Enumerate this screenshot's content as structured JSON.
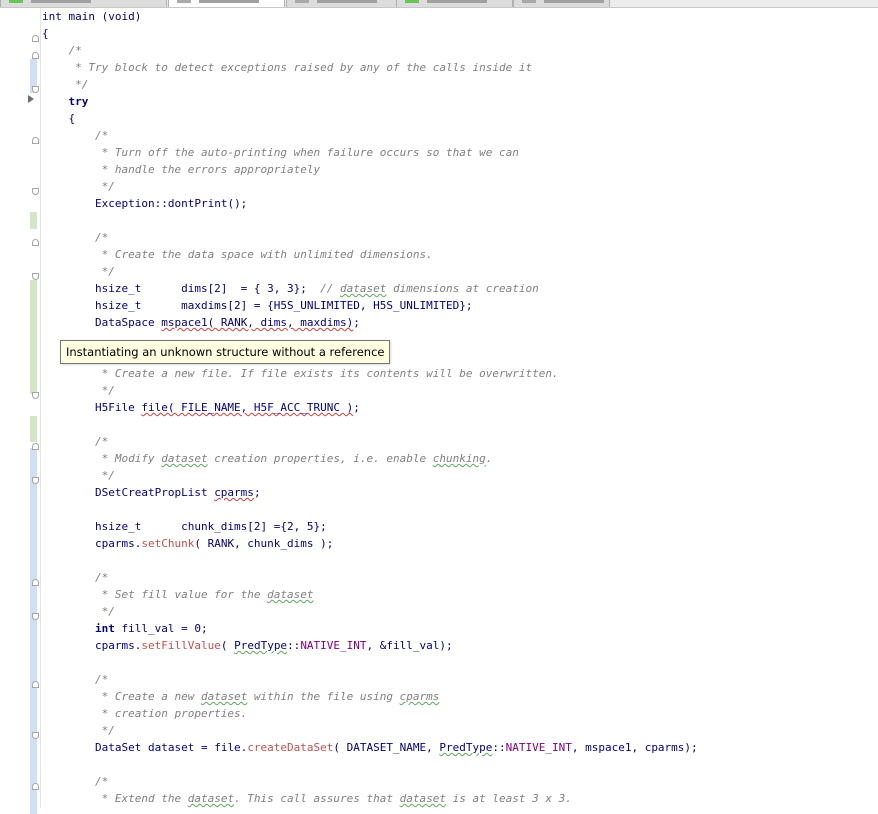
{
  "editor": {
    "lines": [
      [
        {
          "t": "int main (void)",
          "c": "kw-plain"
        }
      ],
      [
        {
          "t": "{"
        }
      ],
      [
        {
          "t": "    /*",
          "c": "cm"
        }
      ],
      [
        {
          "t": "     * Try block to detect exceptions raised by any of the calls inside it",
          "c": "cm"
        }
      ],
      [
        {
          "t": "     */",
          "c": "cm"
        }
      ],
      [
        {
          "t": "    "
        },
        {
          "t": "try",
          "c": "kw"
        }
      ],
      [
        {
          "t": "    {"
        }
      ],
      [
        {
          "t": "        /*",
          "c": "cm"
        }
      ],
      [
        {
          "t": "         * Turn off the auto-printing when failure occurs so that we can",
          "c": "cm"
        }
      ],
      [
        {
          "t": "         * handle the errors appropriately",
          "c": "cm"
        }
      ],
      [
        {
          "t": "         */",
          "c": "cm"
        }
      ],
      [
        {
          "t": "        "
        },
        {
          "t": "Exception",
          "c": "ty"
        },
        {
          "t": "::dontPrint();"
        }
      ],
      [
        {
          "t": ""
        }
      ],
      [
        {
          "t": "        /*",
          "c": "cm"
        }
      ],
      [
        {
          "t": "         * Create the data space with unlimited dimensions.",
          "c": "cm"
        }
      ],
      [
        {
          "t": "         */",
          "c": "cm"
        }
      ],
      [
        {
          "t": "        hsize_t      dims[2]  = { 3, 3};  "
        },
        {
          "t": "// ",
          "c": "cm"
        },
        {
          "t": "dataset",
          "c": "cm gq"
        },
        {
          "t": " dimensions at creation",
          "c": "cm"
        }
      ],
      [
        {
          "t": "        hsize_t      maxdims[2] = {H5S_UNLIMITED, H5S_UNLIMITED};"
        }
      ],
      [
        {
          "t": "        DataSpace ",
          "c": "ty"
        },
        {
          "t": "mspace1( RANK, dims, maxdims)",
          "c": "sq"
        },
        {
          "t": ";"
        }
      ],
      [
        {
          "t": ""
        }
      ],
      [
        {
          "t": "        /*",
          "c": "cm"
        }
      ],
      [
        {
          "t": "         * Create a new file. If file exists its contents will be overwritten.",
          "c": "cm"
        }
      ],
      [
        {
          "t": "         */",
          "c": "cm"
        }
      ],
      [
        {
          "t": "        H5File ",
          "c": "ty"
        },
        {
          "t": "file( FILE_NAME, H5F_ACC_TRUNC )",
          "c": "sq"
        },
        {
          "t": ";"
        }
      ],
      [
        {
          "t": ""
        }
      ],
      [
        {
          "t": "        /*",
          "c": "cm"
        }
      ],
      [
        {
          "t": "         * Modify ",
          "c": "cm"
        },
        {
          "t": "dataset",
          "c": "cm gq"
        },
        {
          "t": " creation properties, i.e. enable ",
          "c": "cm"
        },
        {
          "t": "chunking",
          "c": "cm gq"
        },
        {
          "t": ".",
          "c": "cm"
        }
      ],
      [
        {
          "t": "         */",
          "c": "cm"
        }
      ],
      [
        {
          "t": "        DSetCreatPropList ",
          "c": "ty"
        },
        {
          "t": "cparms",
          "c": "sq"
        },
        {
          "t": ";"
        }
      ],
      [
        {
          "t": ""
        }
      ],
      [
        {
          "t": "        hsize_t      chunk_dims[2] ={2, 5};"
        }
      ],
      [
        {
          "t": "        cparms."
        },
        {
          "t": "setChunk",
          "c": "fn"
        },
        {
          "t": "( RANK, chunk_dims );"
        }
      ],
      [
        {
          "t": ""
        }
      ],
      [
        {
          "t": "        /*",
          "c": "cm"
        }
      ],
      [
        {
          "t": "         * Set fill value for the ",
          "c": "cm"
        },
        {
          "t": "dataset",
          "c": "cm gq"
        }
      ],
      [
        {
          "t": "         */",
          "c": "cm"
        }
      ],
      [
        {
          "t": "        "
        },
        {
          "t": "int",
          "c": "kw"
        },
        {
          "t": " fill_val = 0;"
        }
      ],
      [
        {
          "t": "        cparms."
        },
        {
          "t": "setFillValue",
          "c": "fn"
        },
        {
          "t": "( "
        },
        {
          "t": "PredType",
          "c": "gq"
        },
        {
          "t": "::"
        },
        {
          "t": "NATIVE_INT",
          "c": "en"
        },
        {
          "t": ", &fill_val);"
        }
      ],
      [
        {
          "t": ""
        }
      ],
      [
        {
          "t": "        /*",
          "c": "cm"
        }
      ],
      [
        {
          "t": "         * Create a new ",
          "c": "cm"
        },
        {
          "t": "dataset",
          "c": "cm gq"
        },
        {
          "t": " within the file using ",
          "c": "cm"
        },
        {
          "t": "cparms",
          "c": "cm gq"
        }
      ],
      [
        {
          "t": "         * creation properties.",
          "c": "cm"
        }
      ],
      [
        {
          "t": "         */",
          "c": "cm"
        }
      ],
      [
        {
          "t": "        DataSet ",
          "c": "ty"
        },
        {
          "t": "dataset = file."
        },
        {
          "t": "createDataSet",
          "c": "fn"
        },
        {
          "t": "( DATASET_NAME, "
        },
        {
          "t": "PredType",
          "c": "gq"
        },
        {
          "t": "::"
        },
        {
          "t": "NATIVE_INT",
          "c": "en"
        },
        {
          "t": ", mspace1, cparms);"
        }
      ],
      [
        {
          "t": ""
        }
      ],
      [
        {
          "t": "        /*",
          "c": "cm"
        }
      ],
      [
        {
          "t": "         * Extend the ",
          "c": "cm"
        },
        {
          "t": "dataset",
          "c": "cm gq"
        },
        {
          "t": ". This call assures that ",
          "c": "cm"
        },
        {
          "t": "dataset",
          "c": "cm gq"
        },
        {
          "t": " is at least 3 x 3.",
          "c": "cm"
        }
      ]
    ]
  },
  "tooltip": {
    "text": "Instantiating an unknown structure without a reference"
  }
}
